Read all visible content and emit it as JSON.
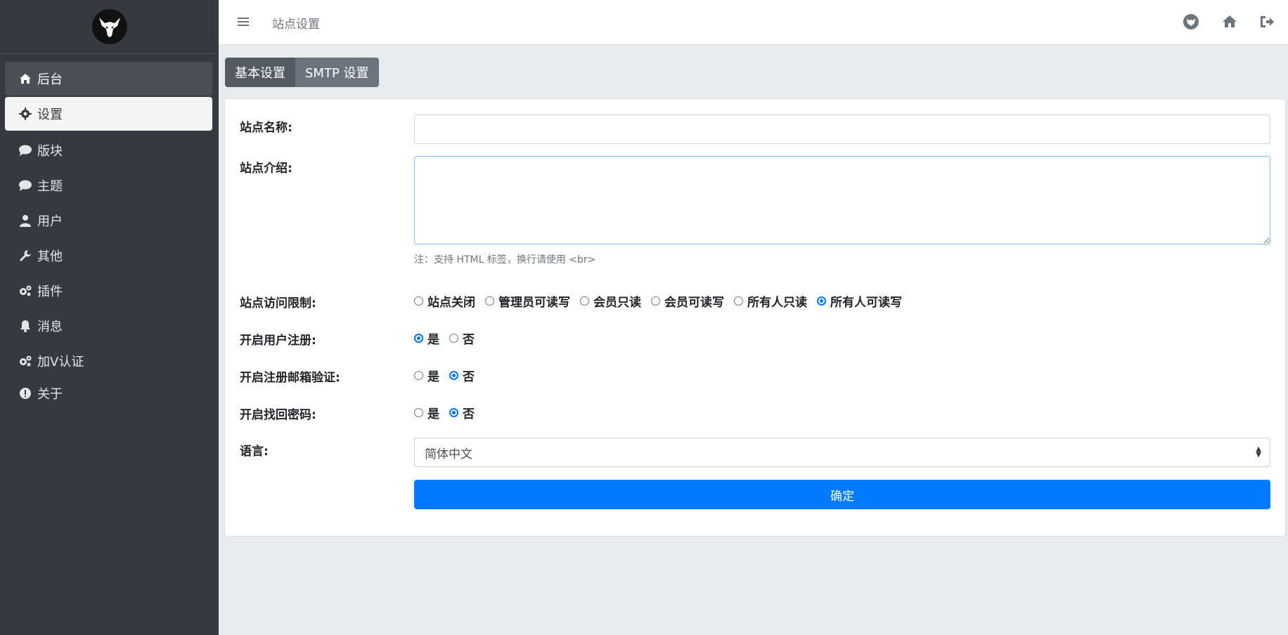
{
  "sidebar": {
    "logo_icon": "bull-head-logo",
    "items": [
      {
        "label": "后台",
        "icon": "home-icon",
        "state": "hover"
      },
      {
        "label": "设置",
        "icon": "gear-icon",
        "state": "active"
      },
      {
        "label": "版块",
        "icon": "chat-bubble-icon",
        "state": ""
      },
      {
        "label": "主题",
        "icon": "chat-bubble-icon",
        "state": ""
      },
      {
        "label": "用户",
        "icon": "user-icon",
        "state": ""
      },
      {
        "label": "其他",
        "icon": "wrench-icon",
        "state": ""
      },
      {
        "label": "插件",
        "icon": "gears-icon",
        "state": ""
      },
      {
        "label": "消息",
        "icon": "bell-icon",
        "state": ""
      },
      {
        "label": "加V认证",
        "icon": "gears-icon",
        "state": ""
      },
      {
        "label": "关于",
        "icon": "exclamation-circle-icon",
        "state": ""
      }
    ]
  },
  "topbar": {
    "breadcrumb": "站点设置",
    "icons": [
      "cat-face-icon",
      "home-icon",
      "sign-out-icon"
    ]
  },
  "tabs": [
    {
      "label": "基本设置",
      "active": true
    },
    {
      "label": "SMTP 设置",
      "active": false
    }
  ],
  "form": {
    "site_name": {
      "label": "站点名称:",
      "value": ""
    },
    "site_intro": {
      "label": "站点介绍:",
      "value": "",
      "help": "注：支持 HTML 标签，换行请使用 <br>"
    },
    "access": {
      "label": "站点访问限制:",
      "options": [
        "站点关闭",
        "管理员可读写",
        "会员只读",
        "会员可读写",
        "所有人只读",
        "所有人可读写"
      ],
      "selected": 5
    },
    "user_register": {
      "label": "开启用户注册:",
      "options": [
        "是",
        "否"
      ],
      "selected": 0
    },
    "email_verify": {
      "label": "开启注册邮箱验证:",
      "options": [
        "是",
        "否"
      ],
      "selected": 1
    },
    "password_recovery": {
      "label": "开启找回密码:",
      "options": [
        "是",
        "否"
      ],
      "selected": 1
    },
    "language": {
      "label": "语言:",
      "value": "简体中文"
    },
    "submit_label": "确定"
  },
  "colors": {
    "sidebar_bg": "#343a40",
    "primary": "#007bff",
    "tab_bg": "#6c757d"
  }
}
